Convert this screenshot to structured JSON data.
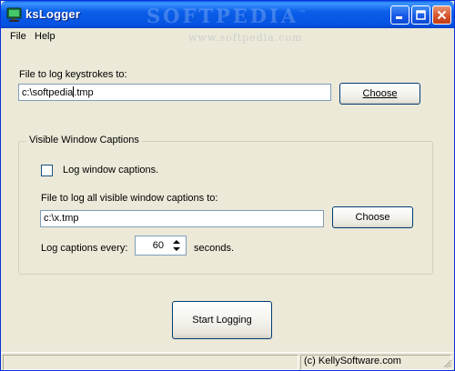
{
  "window": {
    "title": "ksLogger"
  },
  "watermark": {
    "text": "SOFTPEDIA",
    "tm": "™",
    "url": "www.softpedia.com"
  },
  "menu": {
    "file": "File",
    "help": "Help"
  },
  "keystrokes": {
    "label": "File to log keystrokes to:",
    "path_before_caret": "c:\\softpedia",
    "path_after_caret": ".tmp",
    "choose_label": "Choose"
  },
  "captions": {
    "group_title": "Visible Window Captions",
    "log_checkbox_label": "Log window captions.",
    "log_checkbox_checked": false,
    "file_label": "File to log all visible window captions to:",
    "path": "c:\\x.tmp",
    "choose_label": "Choose",
    "every_label": "Log captions every:",
    "interval": "60",
    "seconds_label": "seconds."
  },
  "start_button_label": "Start Logging",
  "status": {
    "copyright": "(c) KellySoftware.com"
  },
  "colors": {
    "titlebar": "#0553e1",
    "close_button": "#d6552e",
    "face": "#ece9d8",
    "input_border": "#7f9db9"
  }
}
